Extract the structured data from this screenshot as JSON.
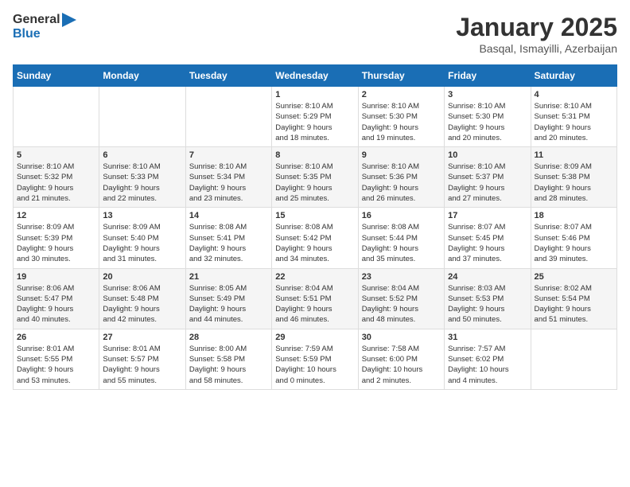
{
  "header": {
    "logo_general": "General",
    "logo_blue": "Blue",
    "month": "January 2025",
    "location": "Basqal, Ismayilli, Azerbaijan"
  },
  "weekdays": [
    "Sunday",
    "Monday",
    "Tuesday",
    "Wednesday",
    "Thursday",
    "Friday",
    "Saturday"
  ],
  "weeks": [
    [
      {
        "day": "",
        "info": ""
      },
      {
        "day": "",
        "info": ""
      },
      {
        "day": "",
        "info": ""
      },
      {
        "day": "1",
        "info": "Sunrise: 8:10 AM\nSunset: 5:29 PM\nDaylight: 9 hours\nand 18 minutes."
      },
      {
        "day": "2",
        "info": "Sunrise: 8:10 AM\nSunset: 5:30 PM\nDaylight: 9 hours\nand 19 minutes."
      },
      {
        "day": "3",
        "info": "Sunrise: 8:10 AM\nSunset: 5:30 PM\nDaylight: 9 hours\nand 20 minutes."
      },
      {
        "day": "4",
        "info": "Sunrise: 8:10 AM\nSunset: 5:31 PM\nDaylight: 9 hours\nand 20 minutes."
      }
    ],
    [
      {
        "day": "5",
        "info": "Sunrise: 8:10 AM\nSunset: 5:32 PM\nDaylight: 9 hours\nand 21 minutes."
      },
      {
        "day": "6",
        "info": "Sunrise: 8:10 AM\nSunset: 5:33 PM\nDaylight: 9 hours\nand 22 minutes."
      },
      {
        "day": "7",
        "info": "Sunrise: 8:10 AM\nSunset: 5:34 PM\nDaylight: 9 hours\nand 23 minutes."
      },
      {
        "day": "8",
        "info": "Sunrise: 8:10 AM\nSunset: 5:35 PM\nDaylight: 9 hours\nand 25 minutes."
      },
      {
        "day": "9",
        "info": "Sunrise: 8:10 AM\nSunset: 5:36 PM\nDaylight: 9 hours\nand 26 minutes."
      },
      {
        "day": "10",
        "info": "Sunrise: 8:10 AM\nSunset: 5:37 PM\nDaylight: 9 hours\nand 27 minutes."
      },
      {
        "day": "11",
        "info": "Sunrise: 8:09 AM\nSunset: 5:38 PM\nDaylight: 9 hours\nand 28 minutes."
      }
    ],
    [
      {
        "day": "12",
        "info": "Sunrise: 8:09 AM\nSunset: 5:39 PM\nDaylight: 9 hours\nand 30 minutes."
      },
      {
        "day": "13",
        "info": "Sunrise: 8:09 AM\nSunset: 5:40 PM\nDaylight: 9 hours\nand 31 minutes."
      },
      {
        "day": "14",
        "info": "Sunrise: 8:08 AM\nSunset: 5:41 PM\nDaylight: 9 hours\nand 32 minutes."
      },
      {
        "day": "15",
        "info": "Sunrise: 8:08 AM\nSunset: 5:42 PM\nDaylight: 9 hours\nand 34 minutes."
      },
      {
        "day": "16",
        "info": "Sunrise: 8:08 AM\nSunset: 5:44 PM\nDaylight: 9 hours\nand 35 minutes."
      },
      {
        "day": "17",
        "info": "Sunrise: 8:07 AM\nSunset: 5:45 PM\nDaylight: 9 hours\nand 37 minutes."
      },
      {
        "day": "18",
        "info": "Sunrise: 8:07 AM\nSunset: 5:46 PM\nDaylight: 9 hours\nand 39 minutes."
      }
    ],
    [
      {
        "day": "19",
        "info": "Sunrise: 8:06 AM\nSunset: 5:47 PM\nDaylight: 9 hours\nand 40 minutes."
      },
      {
        "day": "20",
        "info": "Sunrise: 8:06 AM\nSunset: 5:48 PM\nDaylight: 9 hours\nand 42 minutes."
      },
      {
        "day": "21",
        "info": "Sunrise: 8:05 AM\nSunset: 5:49 PM\nDaylight: 9 hours\nand 44 minutes."
      },
      {
        "day": "22",
        "info": "Sunrise: 8:04 AM\nSunset: 5:51 PM\nDaylight: 9 hours\nand 46 minutes."
      },
      {
        "day": "23",
        "info": "Sunrise: 8:04 AM\nSunset: 5:52 PM\nDaylight: 9 hours\nand 48 minutes."
      },
      {
        "day": "24",
        "info": "Sunrise: 8:03 AM\nSunset: 5:53 PM\nDaylight: 9 hours\nand 50 minutes."
      },
      {
        "day": "25",
        "info": "Sunrise: 8:02 AM\nSunset: 5:54 PM\nDaylight: 9 hours\nand 51 minutes."
      }
    ],
    [
      {
        "day": "26",
        "info": "Sunrise: 8:01 AM\nSunset: 5:55 PM\nDaylight: 9 hours\nand 53 minutes."
      },
      {
        "day": "27",
        "info": "Sunrise: 8:01 AM\nSunset: 5:57 PM\nDaylight: 9 hours\nand 55 minutes."
      },
      {
        "day": "28",
        "info": "Sunrise: 8:00 AM\nSunset: 5:58 PM\nDaylight: 9 hours\nand 58 minutes."
      },
      {
        "day": "29",
        "info": "Sunrise: 7:59 AM\nSunset: 5:59 PM\nDaylight: 10 hours\nand 0 minutes."
      },
      {
        "day": "30",
        "info": "Sunrise: 7:58 AM\nSunset: 6:00 PM\nDaylight: 10 hours\nand 2 minutes."
      },
      {
        "day": "31",
        "info": "Sunrise: 7:57 AM\nSunset: 6:02 PM\nDaylight: 10 hours\nand 4 minutes."
      },
      {
        "day": "",
        "info": ""
      }
    ]
  ]
}
